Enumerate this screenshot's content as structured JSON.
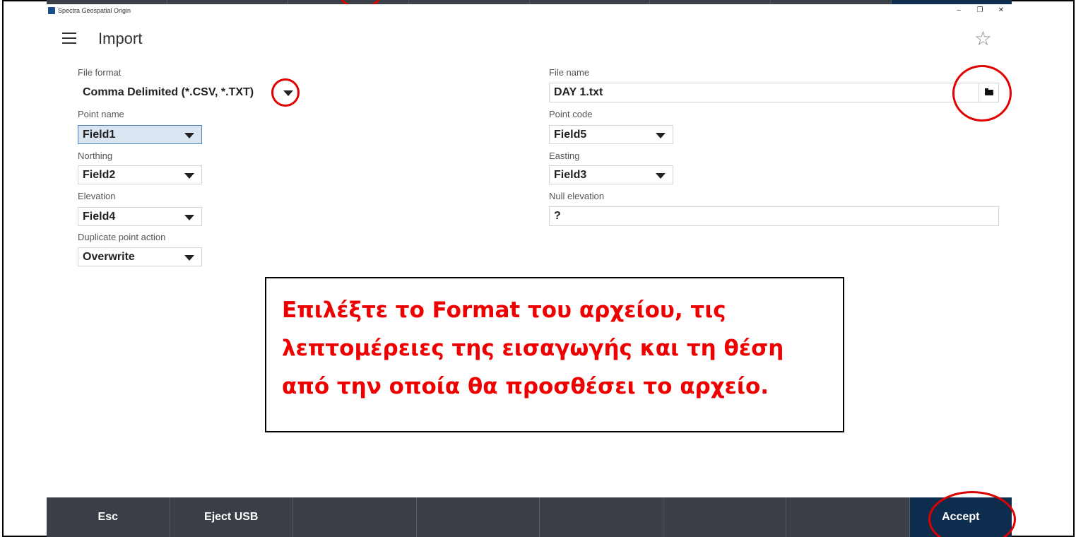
{
  "window": {
    "title": "Spectra Geospatial Origin",
    "controls": [
      "–",
      "❐",
      "✕"
    ]
  },
  "header": {
    "title": "Import",
    "menu_icon": "hamburger-icon",
    "favorite_icon": "star-icon"
  },
  "form": {
    "file_format": {
      "label": "File format",
      "value": "Comma Delimited (*.CSV, *.TXT)"
    },
    "file_name": {
      "label": "File name",
      "value": "DAY 1.txt"
    },
    "point_name": {
      "label": "Point name",
      "value": "Field1"
    },
    "point_code": {
      "label": "Point code",
      "value": "Field5"
    },
    "northing": {
      "label": "Northing",
      "value": "Field2"
    },
    "easting": {
      "label": "Easting",
      "value": "Field3"
    },
    "elevation": {
      "label": "Elevation",
      "value": "Field4"
    },
    "null_elevation": {
      "label": "Null elevation",
      "value": "?"
    },
    "duplicate_action": {
      "label": "Duplicate point action",
      "value": "Overwrite"
    }
  },
  "bottom_bar": {
    "esc": "Esc",
    "eject": "Eject USB",
    "accept": "Accept"
  },
  "callout": {
    "lines": [
      "Επιλέξτε το Format του αρχείου, τις",
      "λεπτομέρειες της εισαγωγής και τη θέση",
      "από την οποία θα προσθέσει το αρχείο."
    ],
    "color": "#ee0000"
  },
  "colors": {
    "bottom_bar": "#3a3f47",
    "accept_button": "#0d2c4e",
    "selected_dropdown": "#d9e5f1",
    "annotation_red": "#e00000"
  }
}
